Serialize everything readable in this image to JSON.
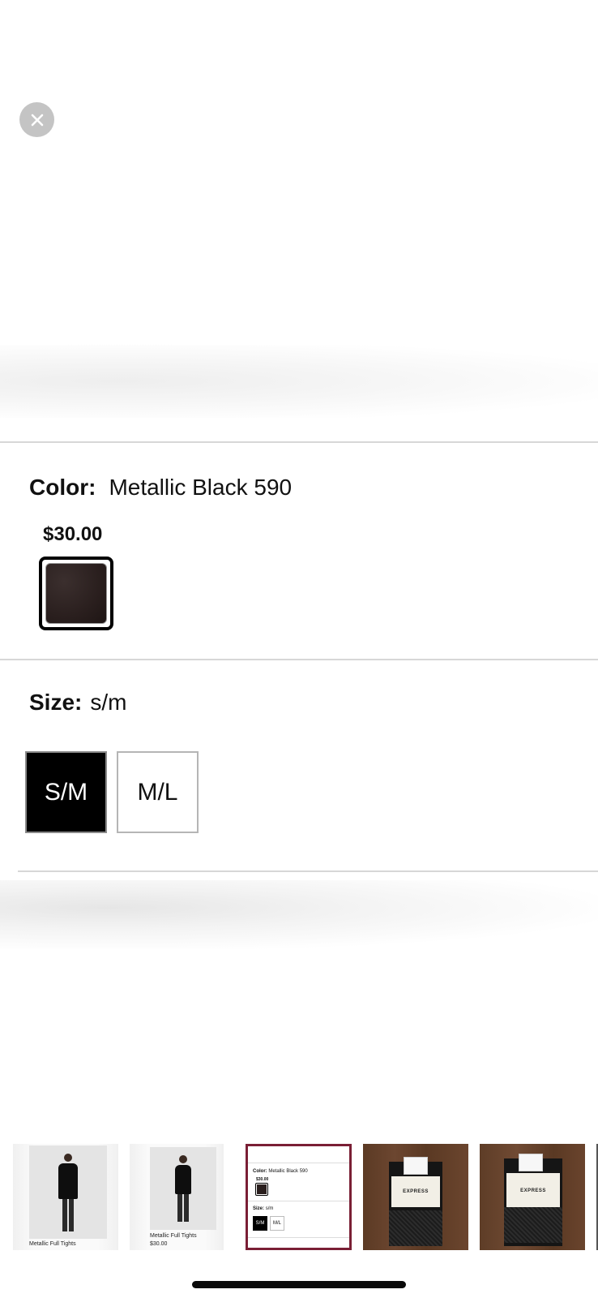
{
  "color": {
    "label": "Color:",
    "value": "Metallic Black 590",
    "price": "$30.00",
    "swatch_color": "#2a1f1e"
  },
  "size": {
    "label": "Size:",
    "value": "s/m",
    "options": [
      "S/M",
      "M/L"
    ],
    "selected": "S/M"
  },
  "thumbnails": [
    {
      "caption": "Metallic Full Tights"
    },
    {
      "caption": "Metallic Full Tights",
      "price": "$30.00"
    },
    {
      "mini": {
        "color_label": "Color:",
        "color_value": "Metallic Black 590",
        "price": "$30.00",
        "size_label": "Size:",
        "size_value": "s/m",
        "sm": "S/M",
        "ml": "M/L"
      },
      "selected": true,
      "border_color": "#7a1f35"
    },
    {
      "brand": "EXPRESS"
    },
    {
      "brand": "EXPRESS"
    }
  ],
  "icons": {
    "close": "close-icon"
  }
}
